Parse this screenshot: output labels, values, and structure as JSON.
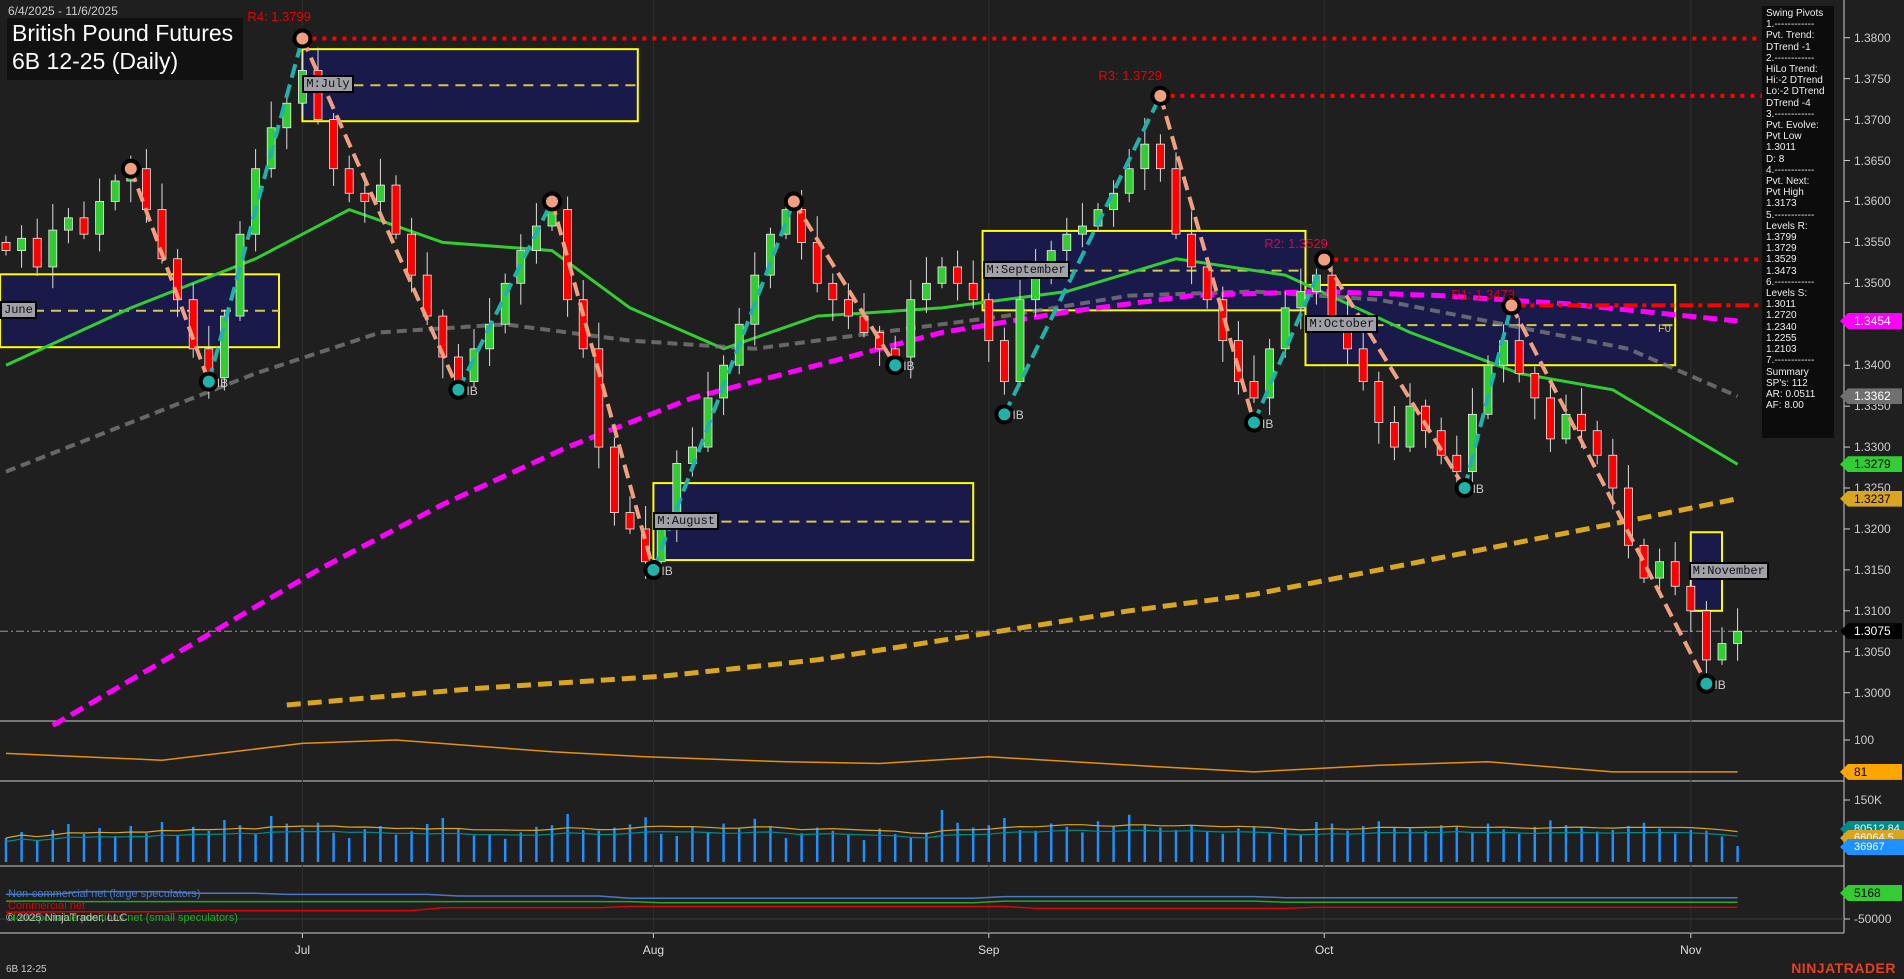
{
  "header": {
    "date_range": "6/4/2025 - 11/6/2025",
    "title_line1": "British Pound Futures",
    "title_line2": "6B 12-25 (Daily)"
  },
  "info_panel": {
    "lines": [
      "Swing Pivots",
      "1.------------",
      "Pvt. Trend:",
      "DTrend -1",
      "2.------------",
      "HiLo Trend:",
      "Hi:-2 DTrend",
      "Lo:-2 DTrend",
      "DTrend -4",
      "3.------------",
      "Pvt. Evolve:",
      "Pvt Low",
      "1.3011",
      "D: 8",
      "4.------------",
      "Pvt. Next:",
      "Pvt High",
      "1.3173",
      "5.------------",
      "Levels R:",
      "1.3799",
      "1.3729",
      "1.3529",
      "1.3473",
      "6.------------",
      "Levels S:",
      "1.3011",
      "1.2720",
      "1.2340",
      "1.2255",
      "1.2103",
      "7.------------",
      "Summary",
      "SP's: 112",
      "AR: 0.0511",
      "AF: 8.00"
    ]
  },
  "colors": {
    "up": "#32cd32",
    "down": "#ff0000",
    "zig_up": "#20b2aa",
    "zig_down": "#f0a080",
    "ma_fast": "#32cd32",
    "ma_mid": "#808080",
    "ma_slow": "#ff00ff",
    "ma_long": "#daa520",
    "box_fill": "#191a52",
    "box_edge": "#ffff00",
    "resistance": "#ff0000"
  },
  "price_axis": {
    "ticks": [
      "1.3800",
      "1.3750",
      "1.3700",
      "1.3650",
      "1.3600",
      "1.3550",
      "1.3500",
      "1.3400",
      "1.3350",
      "1.3300",
      "1.3250",
      "1.3200",
      "1.3150",
      "1.3100",
      "1.3050",
      "1.3000"
    ],
    "flags": [
      {
        "value": "1.3454",
        "bg": "#ff00ff",
        "fg": "#fff"
      },
      {
        "value": "1.3362",
        "bg": "#707070",
        "fg": "#fff"
      },
      {
        "value": "1.3279",
        "bg": "#32cd32",
        "fg": "#000"
      },
      {
        "value": "1.3237",
        "bg": "#daa520",
        "fg": "#000"
      },
      {
        "value": "1.3075",
        "bg": "#000",
        "fg": "#fff"
      }
    ]
  },
  "time_axis": [
    {
      "label": "Jul",
      "bar": 19
    },
    {
      "label": "Aug",
      "bar": 41.5
    },
    {
      "label": "Sep",
      "bar": 63
    },
    {
      "label": "Oct",
      "bar": 84.5
    },
    {
      "label": "Nov",
      "bar": 108
    }
  ],
  "chart_data": {
    "type": "candlestick",
    "title": "British Pound Futures 6B 12-25 (Daily)",
    "ylim": [
      1.296,
      1.384
    ],
    "closes": [
      1.354,
      1.3555,
      1.352,
      1.3565,
      1.358,
      1.356,
      1.36,
      1.3625,
      1.364,
      1.359,
      1.353,
      1.348,
      1.342,
      1.3385,
      1.346,
      1.356,
      1.364,
      1.369,
      1.372,
      1.376,
      1.37,
      1.364,
      1.361,
      1.36,
      1.362,
      1.356,
      1.351,
      1.346,
      1.341,
      1.338,
      1.342,
      1.345,
      1.35,
      1.354,
      1.357,
      1.359,
      1.348,
      1.342,
      1.33,
      1.322,
      1.32,
      1.316,
      1.321,
      1.328,
      1.33,
      1.336,
      1.34,
      1.345,
      1.351,
      1.356,
      1.359,
      1.355,
      1.35,
      1.348,
      1.346,
      1.344,
      1.342,
      1.341,
      1.348,
      1.35,
      1.352,
      1.35,
      1.348,
      1.343,
      1.338,
      1.348,
      1.351,
      1.354,
      1.356,
      1.357,
      1.359,
      1.361,
      1.364,
      1.367,
      1.364,
      1.356,
      1.352,
      1.348,
      1.343,
      1.338,
      1.336,
      1.342,
      1.347,
      1.349,
      1.351,
      1.346,
      1.342,
      1.338,
      1.333,
      1.33,
      1.335,
      1.332,
      1.329,
      1.327,
      1.334,
      1.34,
      1.343,
      1.339,
      1.336,
      1.331,
      1.334,
      1.332,
      1.329,
      1.325,
      1.318,
      1.314,
      1.316,
      1.313,
      1.31,
      1.304,
      1.306,
      1.3075
    ],
    "swing_pivots": [
      {
        "bar": 8,
        "price": 1.364,
        "type": "high"
      },
      {
        "bar": 13,
        "price": 1.338,
        "type": "low"
      },
      {
        "bar": 19,
        "price": 1.3799,
        "type": "high"
      },
      {
        "bar": 29,
        "price": 1.337,
        "type": "low"
      },
      {
        "bar": 35,
        "price": 1.36,
        "type": "high"
      },
      {
        "bar": 41.5,
        "price": 1.315,
        "type": "low"
      },
      {
        "bar": 50.5,
        "price": 1.36,
        "type": "high"
      },
      {
        "bar": 57,
        "price": 1.34,
        "type": "low"
      },
      {
        "bar": 64,
        "price": 1.334,
        "type": "low"
      },
      {
        "bar": 74,
        "price": 1.3729,
        "type": "high"
      },
      {
        "bar": 80,
        "price": 1.333,
        "type": "low"
      },
      {
        "bar": 84.5,
        "price": 1.3529,
        "type": "high"
      },
      {
        "bar": 93.5,
        "price": 1.325,
        "type": "low"
      },
      {
        "bar": 96.5,
        "price": 1.3473,
        "type": "high"
      },
      {
        "bar": 109,
        "price": 1.3011,
        "type": "low"
      }
    ],
    "levels": [
      {
        "label": "R4: 1.3799",
        "price": 1.3799,
        "from_bar": 19
      },
      {
        "label": "R3: 1.3729",
        "price": 1.3729,
        "from_bar": 74
      },
      {
        "label": "R2: 1.3529",
        "price": 1.3529,
        "from_bar": 84.5
      },
      {
        "label": "R1: 1.3473",
        "price": 1.3473,
        "from_bar": 96.5
      }
    ],
    "last_price": 1.3075,
    "monthly_boxes": [
      {
        "label": "June",
        "from": -1,
        "to": 17.5,
        "hi": 1.3511,
        "lo": 1.3422
      },
      {
        "label": "M:July",
        "from": 19,
        "to": 40.5,
        "hi": 1.3786,
        "lo": 1.3698
      },
      {
        "label": "M:August",
        "from": 41.5,
        "to": 62,
        "hi": 1.3256,
        "lo": 1.3162
      },
      {
        "label": "M:September",
        "from": 62.6,
        "to": 83.3,
        "hi": 1.3564,
        "lo": 1.3467
      },
      {
        "label": "M:October",
        "from": 83.3,
        "to": 107,
        "hi": 1.3498,
        "lo": 1.34
      },
      {
        "label": "M:November",
        "from": 108,
        "to": 110,
        "hi": 1.3196,
        "lo": 1.31
      }
    ],
    "moving_averages": [
      {
        "name": "fast",
        "points": [
          [
            0,
            1.34
          ],
          [
            8,
            1.347
          ],
          [
            16,
            1.353
          ],
          [
            22,
            1.359
          ],
          [
            28,
            1.355
          ],
          [
            35,
            1.354
          ],
          [
            40,
            1.347
          ],
          [
            46,
            1.342
          ],
          [
            52,
            1.346
          ],
          [
            60,
            1.347
          ],
          [
            68,
            1.349
          ],
          [
            75,
            1.353
          ],
          [
            82,
            1.351
          ],
          [
            90,
            1.344
          ],
          [
            97,
            1.339
          ],
          [
            103,
            1.337
          ],
          [
            111,
            1.3279
          ]
        ]
      },
      {
        "name": "mid",
        "points": [
          [
            0,
            1.327
          ],
          [
            8,
            1.333
          ],
          [
            16,
            1.339
          ],
          [
            24,
            1.344
          ],
          [
            32,
            1.345
          ],
          [
            40,
            1.343
          ],
          [
            48,
            1.342
          ],
          [
            56,
            1.344
          ],
          [
            64,
            1.346
          ],
          [
            72,
            1.3485
          ],
          [
            80,
            1.349
          ],
          [
            88,
            1.348
          ],
          [
            96,
            1.345
          ],
          [
            104,
            1.342
          ],
          [
            111,
            1.3362
          ]
        ]
      },
      {
        "name": "slow",
        "points": [
          [
            3,
            1.296
          ],
          [
            12,
            1.306
          ],
          [
            20,
            1.315
          ],
          [
            28,
            1.323
          ],
          [
            36,
            1.33
          ],
          [
            44,
            1.336
          ],
          [
            52,
            1.34
          ],
          [
            60,
            1.344
          ],
          [
            68,
            1.3465
          ],
          [
            76,
            1.3485
          ],
          [
            84,
            1.349
          ],
          [
            92,
            1.3485
          ],
          [
            100,
            1.3475
          ],
          [
            111,
            1.3454
          ]
        ]
      },
      {
        "name": "long",
        "points": [
          [
            18,
            1.2985
          ],
          [
            30,
            1.3005
          ],
          [
            42,
            1.302
          ],
          [
            52,
            1.304
          ],
          [
            62,
            1.307
          ],
          [
            72,
            1.31
          ],
          [
            80,
            1.312
          ],
          [
            88,
            1.315
          ],
          [
            96,
            1.318
          ],
          [
            104,
            1.321
          ],
          [
            111,
            1.3237
          ]
        ]
      }
    ],
    "indicator": {
      "tick": "100",
      "value": "81",
      "points": [
        [
          0,
          92
        ],
        [
          10,
          88
        ],
        [
          19,
          98
        ],
        [
          25,
          100
        ],
        [
          35,
          93
        ],
        [
          41,
          90
        ],
        [
          50,
          87
        ],
        [
          56,
          86
        ],
        [
          63,
          90
        ],
        [
          74,
          84
        ],
        [
          80,
          81
        ],
        [
          88,
          85
        ],
        [
          95,
          87
        ],
        [
          103,
          81
        ],
        [
          111,
          81
        ]
      ]
    },
    "volume": {
      "tick": "150K",
      "labels": [
        {
          "value": "80512.84",
          "bg": "#008b8b"
        },
        {
          "value": "66064.5",
          "bg": "#daa520"
        },
        {
          "value": "36967",
          "bg": "#1e90ff"
        }
      ],
      "values_k": [
        60,
        75,
        55,
        80,
        95,
        70,
        85,
        65,
        90,
        72,
        100,
        68,
        88,
        78,
        105,
        92,
        70,
        115,
        96,
        85,
        98,
        73,
        60,
        82,
        90,
        68,
        77,
        95,
        110,
        84,
        66,
        70,
        58,
        74,
        88,
        92,
        120,
        80,
        78,
        86,
        94,
        112,
        70,
        65,
        88,
        74,
        96,
        84,
        108,
        90,
        60,
        72,
        86,
        78,
        68,
        55,
        84,
        70,
        62,
        74,
        130,
        98,
        86,
        92,
        110,
        80,
        78,
        96,
        88,
        74,
        102,
        90,
        118,
        94,
        86,
        80,
        92,
        76,
        70,
        84,
        90,
        74,
        82,
        68,
        100,
        96,
        78,
        90,
        102,
        86,
        84,
        78,
        92,
        88,
        74,
        96,
        82,
        70,
        88,
        104,
        92,
        86,
        76,
        80,
        90,
        98,
        84,
        70,
        80,
        78,
        64,
        40
      ]
    },
    "cot": {
      "tick": "-50000",
      "value": "5168",
      "legend": [
        {
          "label": "Non-commercial net (large speculators)",
          "color": "#4a78c8"
        },
        {
          "label": "Commercial net",
          "color": "#e00000"
        },
        {
          "label": "Nonreportable positions net (small speculators)",
          "color": "#22aa22"
        }
      ],
      "series": [
        {
          "color": "#4a78c8",
          "points": [
            [
              0,
              38000
            ],
            [
              3,
              38000
            ],
            [
              5,
              48000
            ],
            [
              10,
              48000
            ],
            [
              12,
              42000
            ],
            [
              16,
              42000
            ],
            [
              18,
              38000
            ],
            [
              27,
              38000
            ],
            [
              29,
              32000
            ],
            [
              38,
              32000
            ],
            [
              40,
              24000
            ],
            [
              62,
              24000
            ],
            [
              64,
              30000
            ],
            [
              80,
              30000
            ],
            [
              82,
              26000
            ],
            [
              111,
              26000
            ]
          ]
        },
        {
          "color": "#e00000",
          "points": [
            [
              0,
              -26000
            ],
            [
              4,
              -24000
            ],
            [
              10,
              -24000
            ],
            [
              13,
              -20000
            ],
            [
              26,
              -20000
            ],
            [
              28,
              -10000
            ],
            [
              38,
              -10000
            ],
            [
              40,
              -5000
            ],
            [
              64,
              -5000
            ],
            [
              66,
              -12000
            ],
            [
              82,
              -12000
            ],
            [
              84,
              -8000
            ],
            [
              111,
              -8000
            ]
          ]
        },
        {
          "color": "#22aa22",
          "points": [
            [
              0,
              14000
            ],
            [
              3,
              14000
            ],
            [
              5,
              12000
            ],
            [
              40,
              12000
            ],
            [
              42,
              8000
            ],
            [
              62,
              8000
            ],
            [
              64,
              14000
            ],
            [
              80,
              14000
            ],
            [
              82,
              10000
            ],
            [
              111,
              10000
            ]
          ]
        }
      ]
    }
  },
  "footer": {
    "copyright": "© 2025 NinjaTrader, LLC",
    "symbol": "6B 12-25",
    "logo": "NINJATRADER",
    "flag_label": "F0",
    "ib_label": "IB"
  }
}
